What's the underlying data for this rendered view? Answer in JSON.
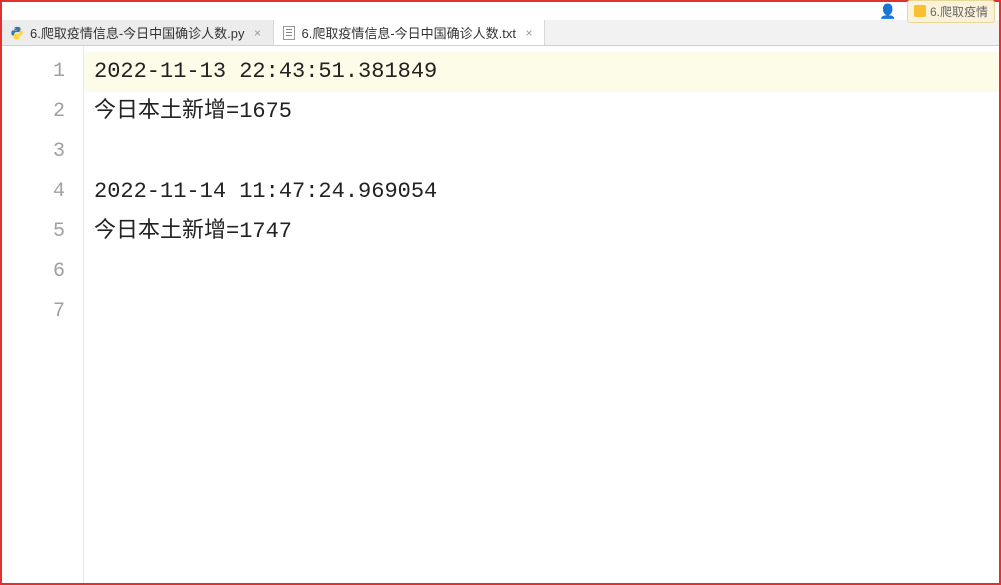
{
  "topbar": {
    "partial_tab_label": "6.爬取疫情"
  },
  "tabs": [
    {
      "label": "6.爬取疫情信息-今日中国确诊人数.py",
      "icon": "python",
      "active": false
    },
    {
      "label": "6.爬取疫情信息-今日中国确诊人数.txt",
      "icon": "text",
      "active": true
    }
  ],
  "editor": {
    "highlighted_line": 1,
    "lines": [
      "2022-11-13 22:43:51.381849",
      "今日本土新增=1675",
      "",
      "2022-11-14 11:47:24.969054",
      "今日本土新增=1747",
      "",
      ""
    ]
  }
}
